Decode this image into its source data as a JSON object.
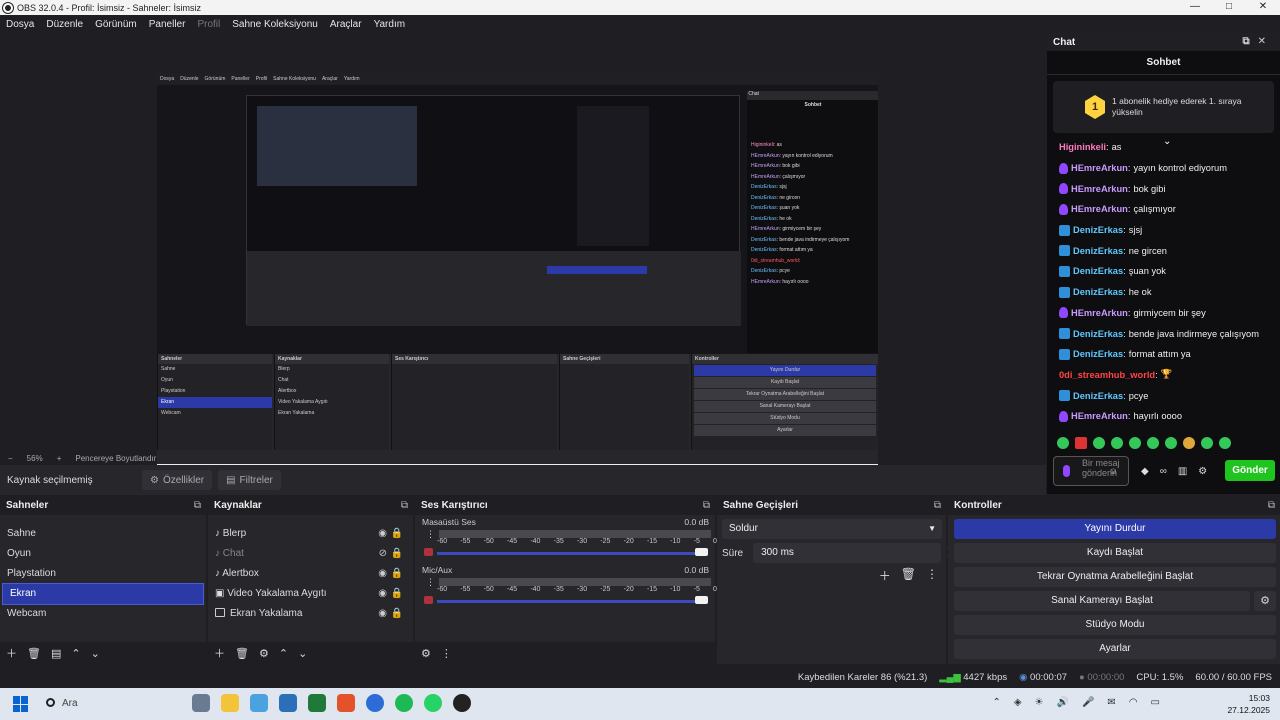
{
  "window": {
    "title": "OBS 32.0.4 - Profil: İsimsiz - Sahneler: İsimsiz",
    "controls": [
      "—",
      "□",
      "✕"
    ]
  },
  "menu": [
    "Dosya",
    "Düzenle",
    "Görünüm",
    "Paneller",
    "Profil",
    "Sahne Koleksiyonu",
    "Araçlar",
    "Yardım"
  ],
  "zoom": {
    "minus": "−",
    "level": "56%",
    "plus": "+",
    "fit": "Pencereye Boyutlandır"
  },
  "source_bar": {
    "label": "Kaynak seçilmemiş",
    "properties": "Özellikler",
    "filters": "Filtreler"
  },
  "chat": {
    "dock_title": "Chat",
    "header": "Sohbet",
    "pinned_badge": "1",
    "pinned_text": "1 abonelik hediye ederek 1. sıraya yükselin",
    "messages": [
      {
        "badge": "",
        "name": "Higininkeli",
        "color": "pink",
        "text": "as"
      },
      {
        "badge": "p",
        "name": "HEmreArkun",
        "color": "purple",
        "text": "yayın kontrol ediyorum"
      },
      {
        "badge": "p",
        "name": "HEmreArkun",
        "color": "purple",
        "text": "bok gibi"
      },
      {
        "badge": "p",
        "name": "HEmreArkun",
        "color": "purple",
        "text": "çalışmıyor"
      },
      {
        "badge": "b",
        "name": "DenizErkas",
        "color": "blue",
        "text": "sjsj"
      },
      {
        "badge": "b",
        "name": "DenizErkas",
        "color": "blue",
        "text": "ne gircen"
      },
      {
        "badge": "b",
        "name": "DenizErkas",
        "color": "blue",
        "text": "şuan yok"
      },
      {
        "badge": "b",
        "name": "DenizErkas",
        "color": "blue",
        "text": "he ok"
      },
      {
        "badge": "p",
        "name": "HEmreArkun",
        "color": "purple",
        "text": "girmiycem bir şey"
      },
      {
        "badge": "b",
        "name": "DenizErkas",
        "color": "blue",
        "text": "bende java indirmeye çalışıyom"
      },
      {
        "badge": "b",
        "name": "DenizErkas",
        "color": "blue",
        "text": "format attım ya"
      },
      {
        "badge": "",
        "name": "0di_streamhub_world",
        "color": "red",
        "text": "🏆"
      },
      {
        "badge": "b",
        "name": "DenizErkas",
        "color": "blue",
        "text": "pcye"
      },
      {
        "badge": "p",
        "name": "HEmreArkun",
        "color": "purple",
        "text": "hayırlı oooo"
      }
    ],
    "input_placeholder": "Bir mesaj gönderin",
    "send": "Gönder"
  },
  "docks": {
    "scenes": {
      "title": "Sahneler",
      "items": [
        "Sahne",
        "Oyun",
        "Playstation",
        "Ekran",
        "Webcam"
      ],
      "selected": 3
    },
    "sources": {
      "title": "Kaynaklar",
      "items": [
        {
          "name": "Blerp",
          "visible": true
        },
        {
          "name": "Chat",
          "visible": false
        },
        {
          "name": "Alertbox",
          "visible": true
        },
        {
          "name": "Video Yakalama Aygıtı",
          "visible": true
        },
        {
          "name": "Ekran Yakalama",
          "visible": true
        }
      ]
    },
    "mixer": {
      "title": "Ses Karıştırıcı",
      "channels": [
        {
          "name": "Masaüstü Ses",
          "db": "0.0 dB"
        },
        {
          "name": "Mic/Aux",
          "db": "0.0 dB"
        }
      ],
      "ticks": [
        "-60",
        "-55",
        "-50",
        "-45",
        "-40",
        "-35",
        "-30",
        "-25",
        "-20",
        "-15",
        "-10",
        "-5",
        "0"
      ]
    },
    "transitions": {
      "title": "Sahne Geçişleri",
      "type": "Soldur",
      "duration_label": "Süre",
      "duration": "300 ms"
    },
    "controls": {
      "title": "Kontroller",
      "buttons": [
        "Yayını Durdur",
        "Kaydı Başlat",
        "Tekrar Oynatma Arabelleğini Başlat",
        "Sanal Kamerayı Başlat",
        "Stüdyo Modu",
        "Ayarlar"
      ]
    }
  },
  "status": {
    "dropped": "Kaybedilen Kareler 86 (%21.3)",
    "bitrate": "4427 kbps",
    "stream_time": "00:00:07",
    "rec_time": "00:00:00",
    "cpu": "CPU: 1.5%",
    "fps": "60.00 / 60.00 FPS"
  },
  "taskbar": {
    "search": "Ara",
    "time": "15:03",
    "date": "27.12.2025"
  },
  "colors": {
    "accent": "#2c3aa8",
    "send": "#1fc41f",
    "bg": "#1f1f23"
  }
}
